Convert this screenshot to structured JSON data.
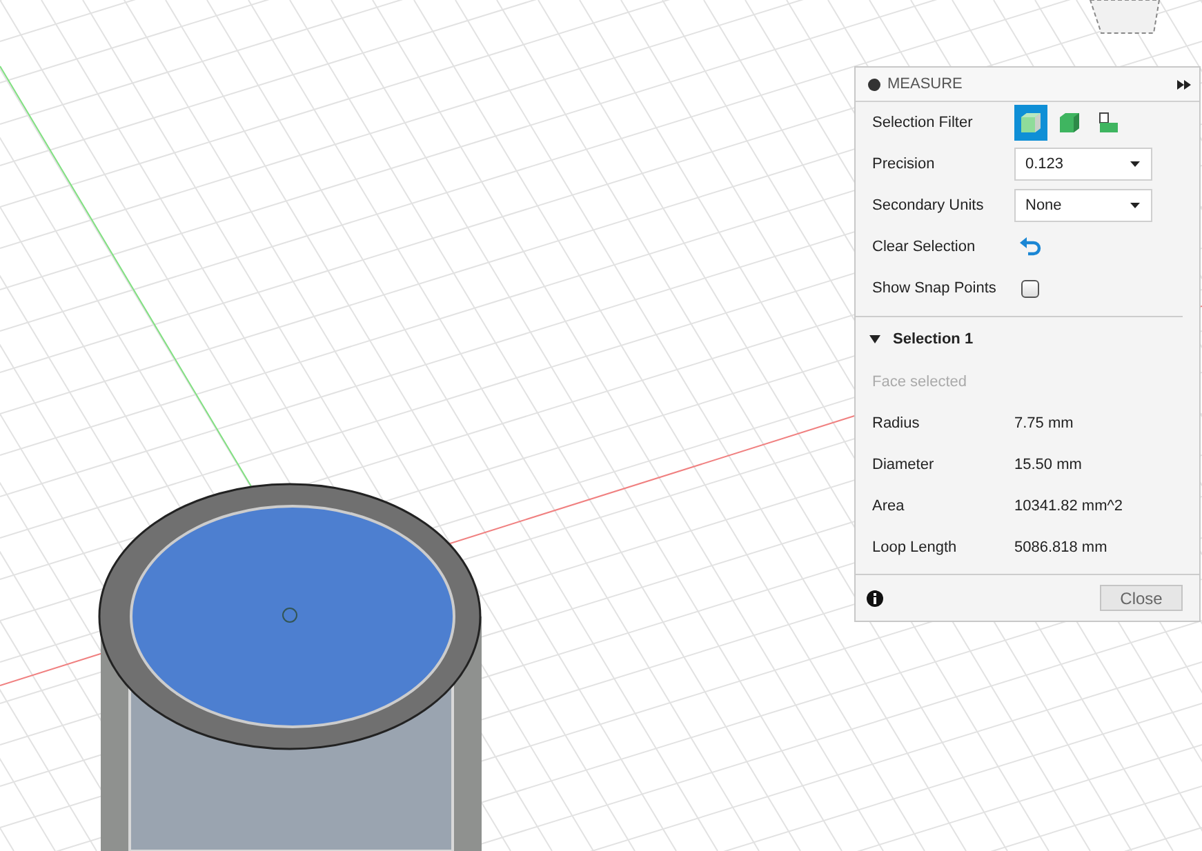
{
  "panel": {
    "title": "MEASURE",
    "settings": [
      {
        "kind": "filter",
        "label": "Selection Filter",
        "filters": [
          {
            "kind": "body",
            "selected": true
          },
          {
            "kind": "face",
            "selected": false
          },
          {
            "kind": "edge",
            "selected": false
          }
        ]
      },
      {
        "kind": "dropdown",
        "label": "Precision",
        "value": "0.123"
      },
      {
        "kind": "dropdown",
        "label": "Secondary Units",
        "value": "None"
      },
      {
        "kind": "action",
        "label": "Clear Selection"
      },
      {
        "kind": "checkbox",
        "label": "Show Snap Points",
        "checked": false
      }
    ],
    "selection": {
      "title": "Selection 1",
      "expanded": true,
      "status": "Face selected",
      "properties": [
        {
          "label": "Radius",
          "value": "7.75 mm"
        },
        {
          "label": "Diameter",
          "value": "15.50 mm"
        },
        {
          "label": "Area",
          "value": "10341.82 mm^2"
        },
        {
          "label": "Loop Length",
          "value": "5086.818 mm"
        }
      ]
    },
    "close_button": "Close"
  }
}
